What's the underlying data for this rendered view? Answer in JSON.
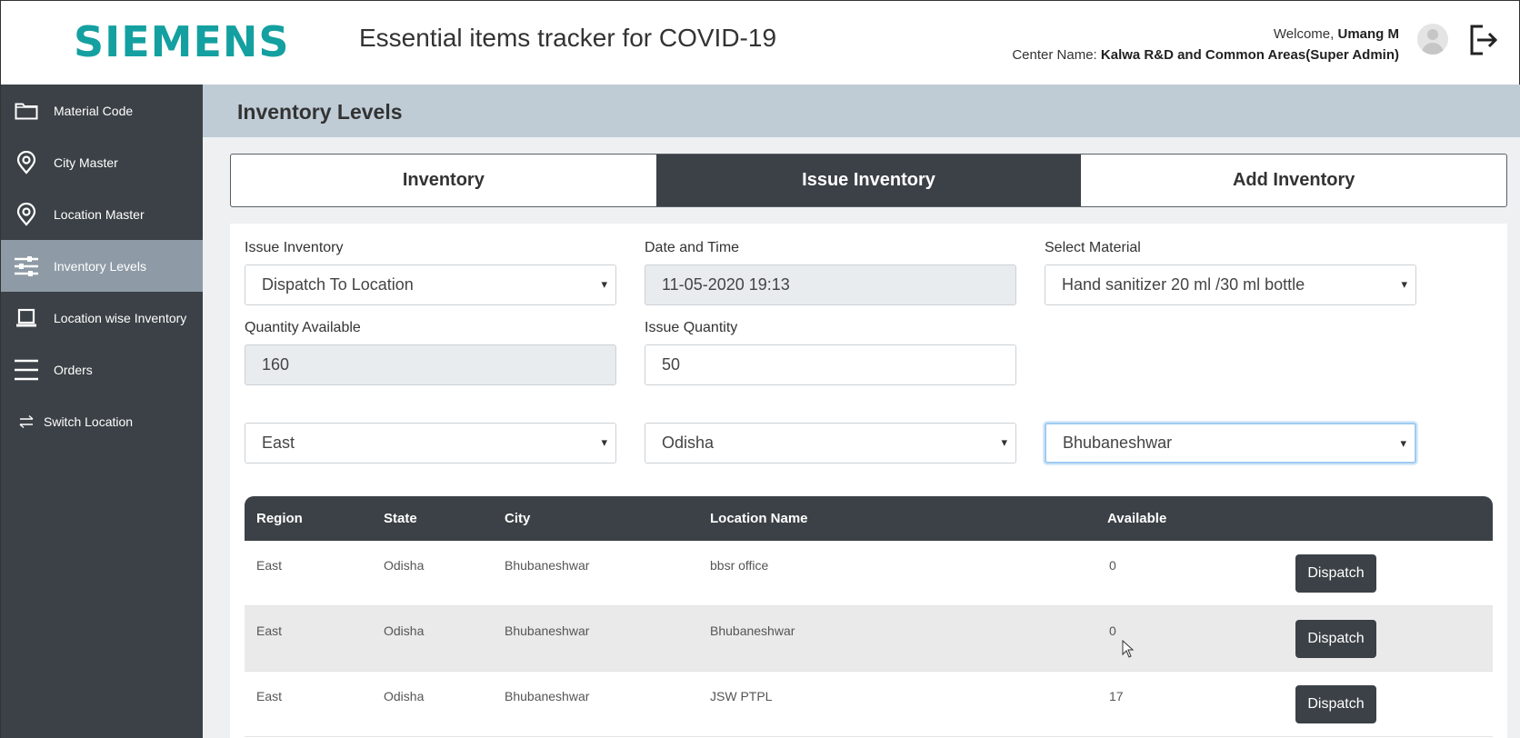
{
  "header": {
    "logo": "SIEMENS",
    "app_title": "Essential items tracker for COVID-19",
    "welcome_label": "Welcome,",
    "user_name": "Umang M",
    "center_label": "Center Name:",
    "center_name": "Kalwa R&D and Common Areas(Super Admin)"
  },
  "sidebar": {
    "items": [
      {
        "label": "Material Code",
        "icon": "folder-icon"
      },
      {
        "label": "City Master",
        "icon": "location-pin-icon"
      },
      {
        "label": "Location Master",
        "icon": "location-pin-icon"
      },
      {
        "label": "Inventory Levels",
        "icon": "sliders-icon",
        "active": true
      },
      {
        "label": "Location wise Inventory",
        "icon": "laptop-icon"
      },
      {
        "label": "Orders",
        "icon": "menu-icon"
      },
      {
        "label": "Switch Location",
        "icon": "switch-arrows-icon"
      }
    ]
  },
  "page": {
    "title": "Inventory Levels",
    "tabs": [
      "Inventory",
      "Issue Inventory",
      "Add Inventory"
    ],
    "active_tab": "Issue Inventory"
  },
  "form": {
    "issue_inventory": {
      "label": "Issue Inventory",
      "value": "Dispatch To Location"
    },
    "date_time": {
      "label": "Date and Time",
      "value": "11-05-2020 19:13"
    },
    "select_material": {
      "label": "Select Material",
      "value": "Hand sanitizer 20 ml /30 ml bottle"
    },
    "quantity_available": {
      "label": "Quantity Available",
      "value": "160"
    },
    "issue_quantity": {
      "label": "Issue Quantity",
      "value": "50"
    },
    "region": {
      "value": "East"
    },
    "state": {
      "value": "Odisha"
    },
    "city": {
      "value": "Bhubaneshwar"
    }
  },
  "table": {
    "columns": [
      "Region",
      "State",
      "City",
      "Location Name",
      "Available"
    ],
    "rows": [
      {
        "region": "East",
        "state": "Odisha",
        "city": "Bhubaneshwar",
        "location": "bbsr office",
        "available": "0",
        "action": "Dispatch"
      },
      {
        "region": "East",
        "state": "Odisha",
        "city": "Bhubaneshwar",
        "location": "Bhubaneshwar",
        "available": "0",
        "action": "Dispatch"
      },
      {
        "region": "East",
        "state": "Odisha",
        "city": "Bhubaneshwar",
        "location": "JSW PTPL",
        "available": "17",
        "action": "Dispatch"
      }
    ]
  },
  "colors": {
    "brand": "#14a0a0",
    "sidebar_bg": "#3b4146",
    "sidebar_active": "#8e9ba6",
    "title_bar": "#bfccd6"
  }
}
